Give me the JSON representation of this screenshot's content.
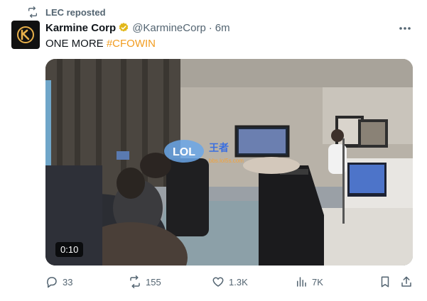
{
  "repost": {
    "label": "LEC reposted"
  },
  "account": {
    "name": "Karmine Corp",
    "handle": "@KarmineCorp",
    "separator": "·",
    "time": "6m"
  },
  "tweet": {
    "text": "ONE MORE ",
    "hashtag": "#CFOWIN"
  },
  "media": {
    "duration": "0:10",
    "watermark_main": "王者",
    "watermark_sub": "bbs.lol5s.com",
    "brand_colors": {
      "accent": "#f29c1f",
      "muted": "#536471"
    }
  },
  "metrics": {
    "replies": "33",
    "reposts": "155",
    "likes": "1.3K",
    "views": "7K"
  }
}
